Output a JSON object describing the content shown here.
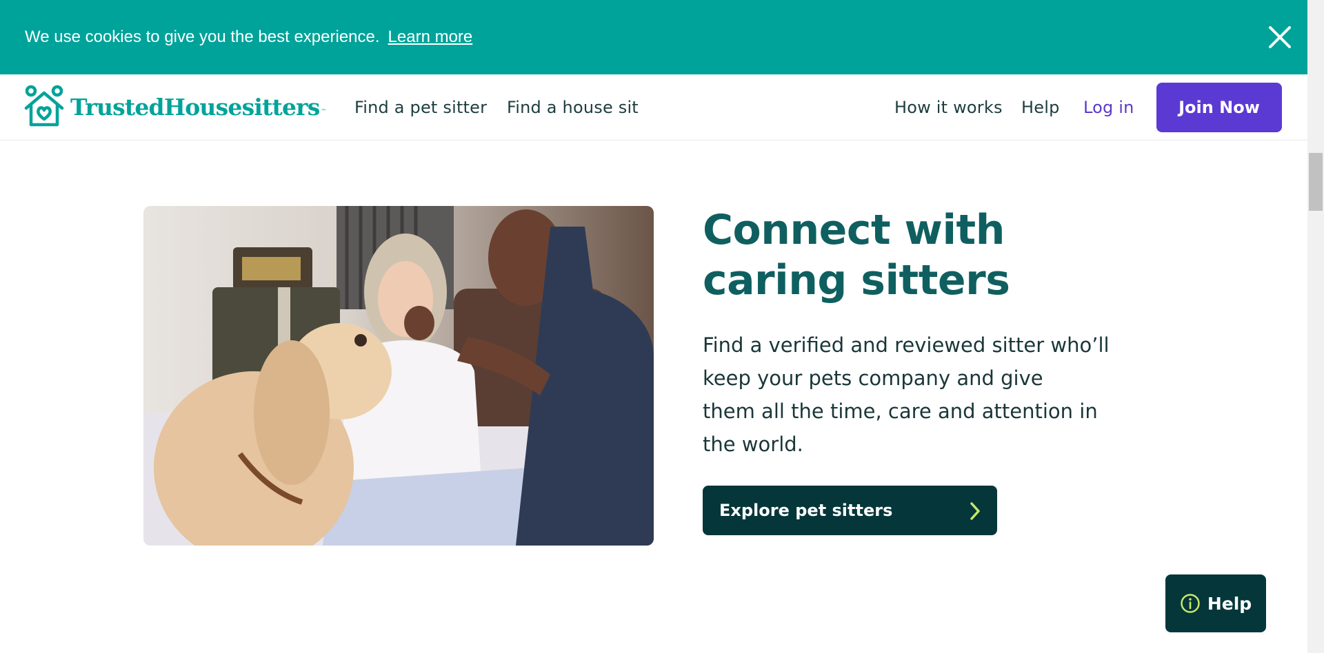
{
  "cookie_banner": {
    "message": "We use cookies to give you the best experience.",
    "learn_more": "Learn more"
  },
  "header": {
    "logo_text": "TrustedHousesitters",
    "logo_tm": "™",
    "nav_left": [
      "Find a pet sitter",
      "Find a house sit"
    ],
    "nav_right": {
      "how_it_works": "How it works",
      "help": "Help",
      "log_in": "Log in",
      "join_now": "Join Now"
    }
  },
  "hero": {
    "title_line1": "Connect with",
    "title_line2": "caring sitters",
    "body_lines": [
      "Find a verified and reviewed sitter who’ll",
      "keep your pets company and give",
      "them all the time, care and attention in",
      "the world."
    ],
    "cta_label": "Explore pet sitters"
  },
  "help_button": {
    "label": "Help"
  },
  "colors": {
    "brand_teal": "#00a39a",
    "dark_teal": "#05363a",
    "purple": "#5b3ad4",
    "heading": "#0f5f60"
  }
}
